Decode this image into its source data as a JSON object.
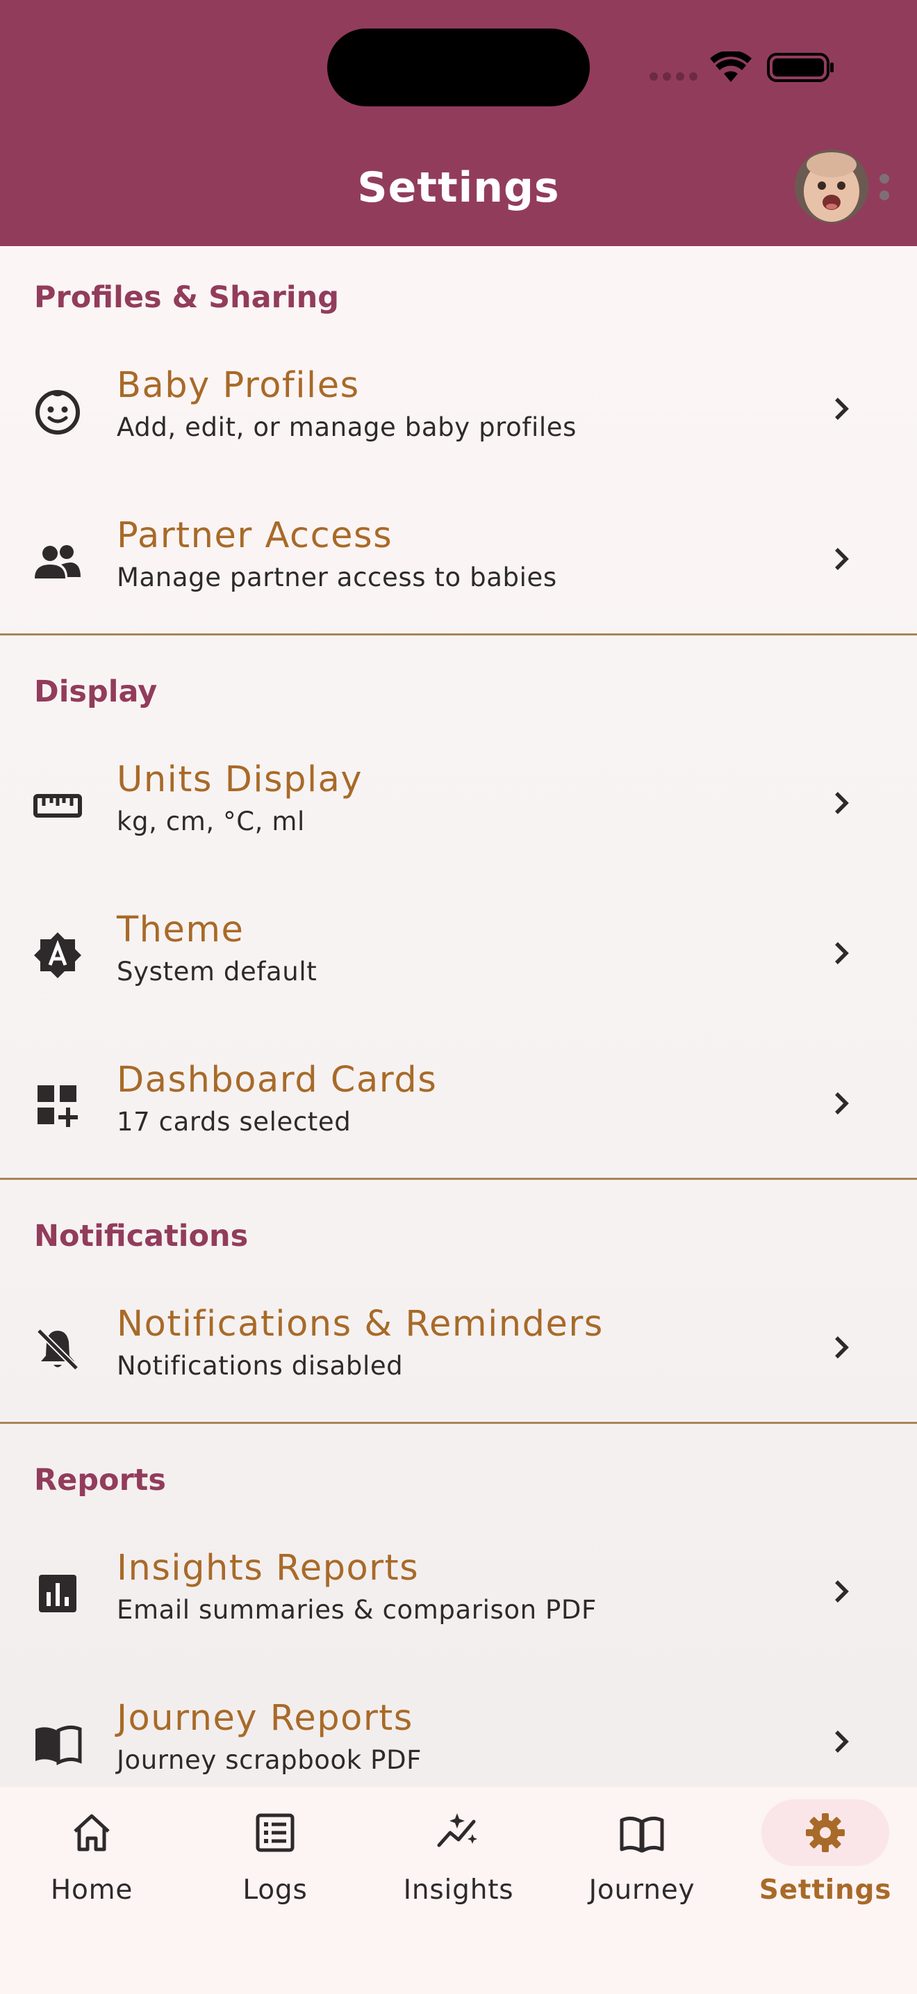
{
  "header": {
    "title": "Settings"
  },
  "sections": [
    {
      "title": "Profiles & Sharing",
      "items": [
        {
          "title": "Baby Profiles",
          "subtitle": "Add, edit, or manage baby profiles",
          "icon": "baby-face-icon"
        },
        {
          "title": "Partner Access",
          "subtitle": "Manage partner access to babies",
          "icon": "people-icon"
        }
      ]
    },
    {
      "title": "Display",
      "items": [
        {
          "title": "Units Display",
          "subtitle": "kg, cm, °C, ml",
          "icon": "ruler-icon"
        },
        {
          "title": "Theme",
          "subtitle": "System default",
          "icon": "brightness-auto-icon"
        },
        {
          "title": "Dashboard Cards",
          "subtitle": "17 cards selected",
          "icon": "dashboard-add-icon"
        }
      ]
    },
    {
      "title": "Notifications",
      "items": [
        {
          "title": "Notifications & Reminders",
          "subtitle": "Notifications disabled",
          "icon": "bell-off-icon"
        }
      ]
    },
    {
      "title": "Reports",
      "items": [
        {
          "title": "Insights Reports",
          "subtitle": "Email summaries & comparison PDF",
          "icon": "bar-chart-icon"
        },
        {
          "title": "Journey Reports",
          "subtitle": "Journey scrapbook PDF",
          "icon": "open-book-icon"
        }
      ]
    }
  ],
  "bottom_nav": {
    "items": [
      {
        "label": "Home",
        "icon": "home-icon"
      },
      {
        "label": "Logs",
        "icon": "list-icon"
      },
      {
        "label": "Insights",
        "icon": "sparkle-chart-icon"
      },
      {
        "label": "Journey",
        "icon": "book-icon"
      },
      {
        "label": "Settings",
        "icon": "gear-icon",
        "active": true
      }
    ]
  },
  "colors": {
    "app_bar": "#923c5c",
    "section_header": "#923c5c",
    "item_title": "#a86a28",
    "active_nav": "#a86a28",
    "divider": "#a98456"
  }
}
